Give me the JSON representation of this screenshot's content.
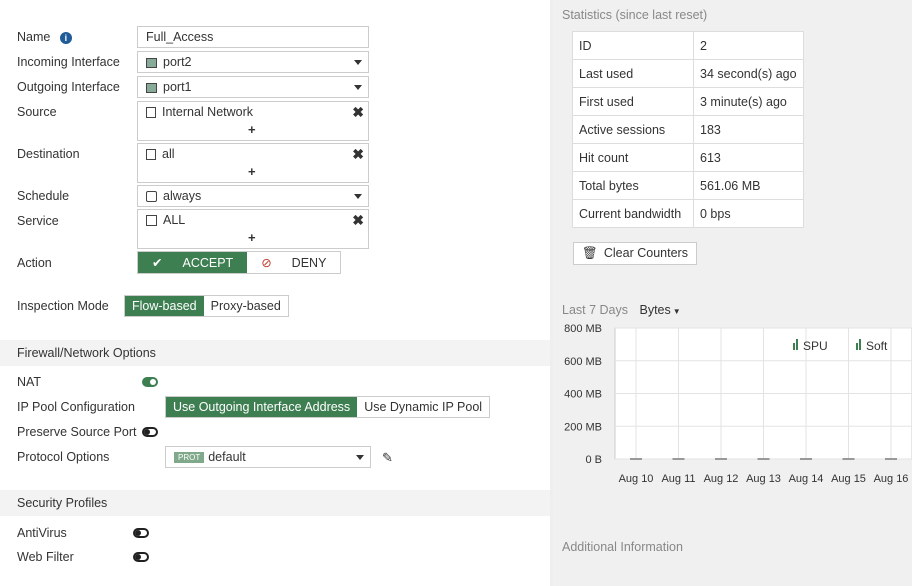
{
  "form": {
    "name": {
      "label": "Name",
      "value": "Full_Access"
    },
    "incoming": {
      "label": "Incoming Interface",
      "value": "port2"
    },
    "outgoing": {
      "label": "Outgoing Interface",
      "value": "port1"
    },
    "source": {
      "label": "Source",
      "value": "Internal Network",
      "add": "+",
      "remove": "✖"
    },
    "destination": {
      "label": "Destination",
      "value": "all",
      "add": "+",
      "remove": "✖"
    },
    "schedule": {
      "label": "Schedule",
      "value": "always"
    },
    "service": {
      "label": "Service",
      "value": "ALL",
      "add": "+",
      "remove": "✖"
    },
    "action": {
      "label": "Action",
      "accept": "ACCEPT",
      "deny": "DENY",
      "selected": "ACCEPT"
    },
    "inspection": {
      "label": "Inspection Mode",
      "flow": "Flow-based",
      "proxy": "Proxy-based",
      "selected": "Flow-based"
    }
  },
  "firewall": {
    "title": "Firewall/Network Options",
    "nat": {
      "label": "NAT",
      "enabled": true
    },
    "ip_pool": {
      "label": "IP Pool Configuration",
      "option1": "Use Outgoing Interface Address",
      "option2": "Use Dynamic IP Pool",
      "selected": "Use Outgoing Interface Address"
    },
    "preserve": {
      "label": "Preserve Source Port",
      "enabled": false
    },
    "protocol": {
      "label": "Protocol Options",
      "badge": "PROT",
      "value": "default"
    }
  },
  "security": {
    "title": "Security Profiles",
    "antivirus": {
      "label": "AntiVirus",
      "enabled": false
    },
    "webfilter": {
      "label": "Web Filter",
      "enabled": false
    }
  },
  "stats": {
    "title": "Statistics (since last reset)",
    "rows": [
      {
        "k": "ID",
        "v": "2"
      },
      {
        "k": "Last used",
        "v": "34 second(s) ago"
      },
      {
        "k": "First used",
        "v": "3 minute(s) ago"
      },
      {
        "k": "Active sessions",
        "v": "183"
      },
      {
        "k": "Hit count",
        "v": "613"
      },
      {
        "k": "Total bytes",
        "v": "561.06 MB"
      },
      {
        "k": "Current bandwidth",
        "v": "0 bps"
      }
    ],
    "clear": "Clear Counters"
  },
  "chart": {
    "period": "Last 7 Days",
    "metric": "Bytes",
    "legend": [
      "SPU",
      "Soft"
    ],
    "additional": "Additional Information"
  },
  "chart_data": {
    "type": "line",
    "categories": [
      "Aug 10",
      "Aug 11",
      "Aug 12",
      "Aug 13",
      "Aug 14",
      "Aug 15",
      "Aug 16"
    ],
    "ytick_labels": [
      "800 MB",
      "600 MB",
      "400 MB",
      "200 MB",
      "0 B"
    ],
    "ylim": [
      0,
      800
    ],
    "series": [
      {
        "name": "SPU",
        "values": [
          0,
          0,
          0,
          0,
          0,
          0,
          0
        ]
      },
      {
        "name": "Soft",
        "values": [
          0,
          0,
          0,
          0,
          0,
          0,
          0
        ]
      }
    ],
    "grid": true,
    "legend_position": "top-right"
  }
}
